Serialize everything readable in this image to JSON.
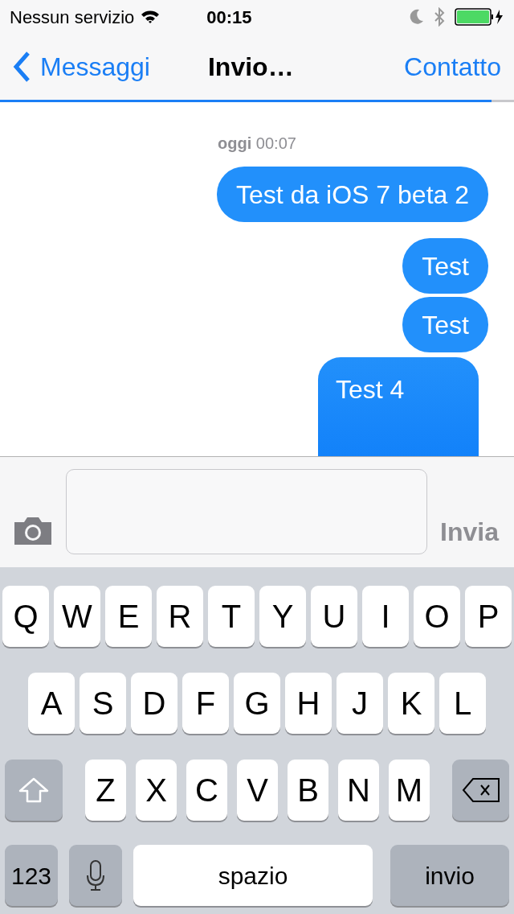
{
  "status_bar": {
    "carrier": "Nessun servizio",
    "time": "00:15"
  },
  "nav": {
    "back": "Messaggi",
    "title": "Invio…",
    "action": "Contatto",
    "progress": {
      "level": 0.956
    }
  },
  "conversation": {
    "timestamp": "**oggi** 00:07",
    "messages": [
      {
        "text": "Test da iOS 7 beta 2"
      },
      {
        "text": "Test"
      },
      {
        "text": "Test"
      },
      {
        "text": "Test 4",
        "kind": "tall"
      }
    ]
  },
  "composer": {
    "send": {
      "label": "Invia",
      "disabled": true
    }
  },
  "keyboard": {
    "rows": [
      [
        {
          "kind": "letter",
          "label": "Q"
        },
        {
          "kind": "letter",
          "label": "W"
        },
        {
          "kind": "letter",
          "label": "E"
        },
        {
          "kind": "letter",
          "label": "R"
        },
        {
          "kind": "letter",
          "label": "T"
        },
        {
          "kind": "letter",
          "label": "Y"
        },
        {
          "kind": "letter",
          "label": "U"
        },
        {
          "kind": "letter",
          "label": "I"
        },
        {
          "kind": "letter",
          "label": "O"
        },
        {
          "kind": "letter",
          "label": "P"
        }
      ],
      [
        {
          "kind": "letter",
          "label": "A"
        },
        {
          "kind": "letter",
          "label": "S"
        },
        {
          "kind": "letter",
          "label": "D"
        },
        {
          "kind": "letter",
          "label": "F"
        },
        {
          "kind": "letter",
          "label": "G"
        },
        {
          "kind": "letter",
          "label": "H"
        },
        {
          "kind": "letter",
          "label": "J"
        },
        {
          "kind": "letter",
          "label": "K"
        },
        {
          "kind": "letter",
          "label": "L"
        }
      ],
      [
        {
          "kind": "shift"
        },
        {
          "kind": "letter",
          "label": "Z"
        },
        {
          "kind": "letter",
          "label": "X"
        },
        {
          "kind": "letter",
          "label": "C"
        },
        {
          "kind": "letter",
          "label": "V"
        },
        {
          "kind": "letter",
          "label": "B"
        },
        {
          "kind": "letter",
          "label": "N"
        },
        {
          "kind": "letter",
          "label": "M"
        },
        {
          "kind": "delete"
        }
      ]
    ],
    "bottom_row": {
      "numbers": {
        "label": "123"
      },
      "space": {
        "label": "spazio"
      },
      "return": {
        "label": "invio"
      }
    }
  }
}
